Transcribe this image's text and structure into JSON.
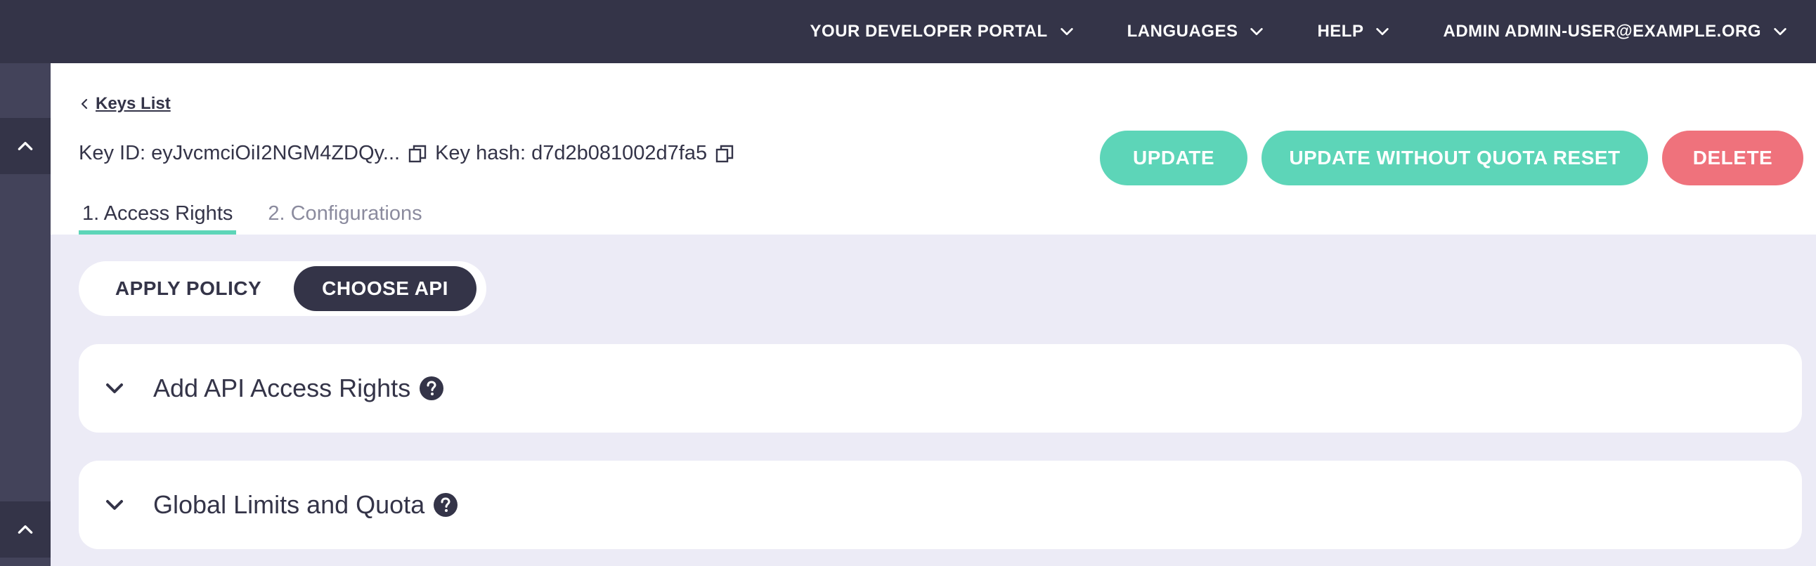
{
  "topnav": {
    "items": [
      {
        "label": "YOUR DEVELOPER PORTAL"
      },
      {
        "label": "LANGUAGES"
      },
      {
        "label": "HELP"
      },
      {
        "label": "ADMIN ADMIN-USER@EXAMPLE.ORG"
      }
    ]
  },
  "header": {
    "back_label": "Keys List",
    "key_id_label": "Key ID: eyJvcmciOiI2NGM4ZDQy...",
    "key_hash_label": "Key hash: d7d2b081002d7fa5",
    "buttons": {
      "update": "UPDATE",
      "update_no_quota": "UPDATE WITHOUT QUOTA RESET",
      "delete": "DELETE"
    },
    "tabs": [
      {
        "label": "1. Access Rights",
        "active": true
      },
      {
        "label": "2. Configurations",
        "active": false
      }
    ]
  },
  "mode_toggle": {
    "options": [
      {
        "label": "APPLY POLICY",
        "selected": false
      },
      {
        "label": "CHOOSE API",
        "selected": true
      }
    ]
  },
  "panels": [
    {
      "title": "Add API Access Rights"
    },
    {
      "title": "Global Limits and Quota"
    }
  ],
  "colors": {
    "nav_bg": "#343448",
    "accent_green": "#5dd5b8",
    "danger_red": "#ef727c",
    "page_bg": "#ecebf6"
  },
  "icons": {
    "chevron": "chevron-down-icon",
    "copy": "copy-icon",
    "help": "question-circle-icon",
    "collapse": "chevron-up-icon",
    "back": "chevron-left-icon"
  }
}
